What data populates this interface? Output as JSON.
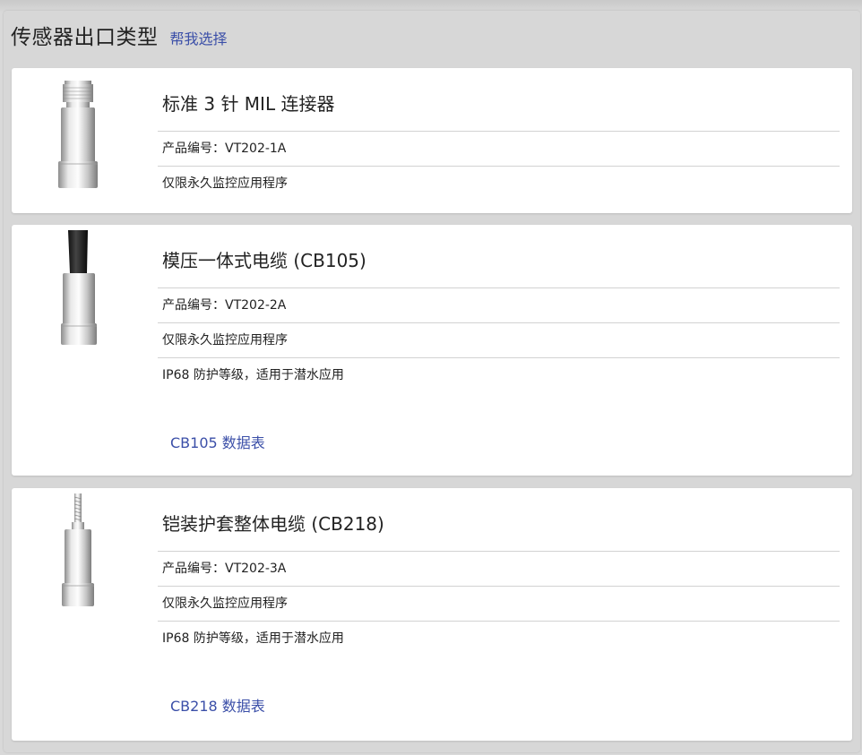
{
  "header": {
    "title": "传感器出口类型",
    "help_link": "帮我选择"
  },
  "cards": [
    {
      "title": "标准 3 针 MIL 连接器",
      "rows": [
        "产品编号：VT202-1A",
        "仅限永久监控应用程序"
      ],
      "image_icon": "mil-connector-sensor-icon"
    },
    {
      "title": "模压一体式电缆 (CB105)",
      "rows": [
        "产品编号：VT202-2A",
        "仅限永久监控应用程序",
        "IP68 防护等级，适用于潜水应用"
      ],
      "datasheet": "CB105 数据表",
      "image_icon": "molded-cable-sensor-icon"
    },
    {
      "title": "铠装护套整体电缆 (CB218)",
      "rows": [
        "产品编号：VT202-3A",
        "仅限永久监控应用程序",
        "IP68 防护等级，适用于潜水应用"
      ],
      "datasheet": "CB218 数据表",
      "image_icon": "armored-cable-sensor-icon"
    }
  ],
  "colors": {
    "link": "#3b4fa8",
    "panel_bg": "#d7d7d7",
    "card_bg": "#ffffff",
    "divider": "#d2d2d2"
  }
}
